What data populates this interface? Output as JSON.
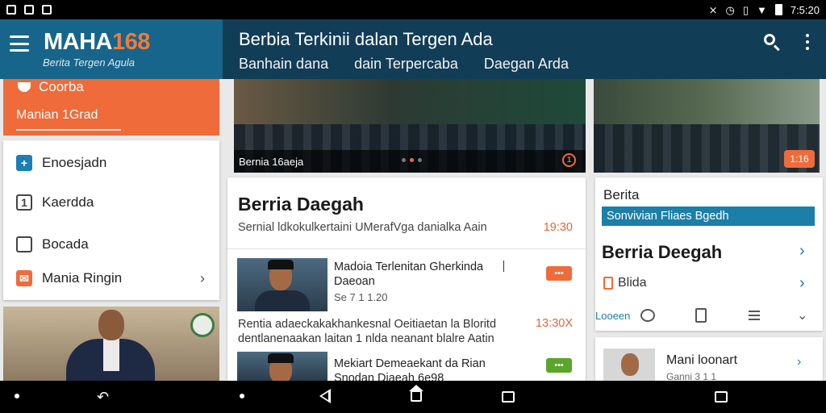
{
  "status_bar": {
    "time": "7:5:20",
    "left_icons": [
      "notification-icon",
      "photo-icon",
      "image-icon"
    ],
    "right_icons": [
      "mute-icon",
      "alarm-icon",
      "vibrate-icon",
      "wifi-icon",
      "battery-icon"
    ]
  },
  "brand": {
    "logo_prefix": "MAHA",
    "logo_suffix": "168",
    "tagline": "Berita Tergen Agula",
    "menu_icon": "hamburger-icon",
    "colors": {
      "brand_blue": "#17658a",
      "accent_orange": "#ef6b3a",
      "header_navy": "#123d57"
    }
  },
  "header": {
    "title": "Berbia Terkinii dalan Tergen Ada",
    "subnav": [
      "Banhain dana",
      "dain  Terpercaba",
      "Daegan  Arda"
    ],
    "search_icon": "search-icon",
    "more_icon": "more-vert-icon"
  },
  "drawer": {
    "head_item": "Coorba",
    "head_sub": "Manian 1Grad",
    "items": [
      {
        "label": "Enoesjadn",
        "icon": "plus-icon"
      },
      {
        "label": "Kaerdda",
        "icon": "box-icon"
      },
      {
        "label": "Bocada",
        "icon": "chat-icon"
      },
      {
        "label": "Mania Ringin",
        "icon": "mail-icon"
      }
    ]
  },
  "featured": {
    "caption": "Bernia 16aeja",
    "badge": "1",
    "right_tag": "1:16"
  },
  "main_card": {
    "title": "Berria Daegah",
    "subtitle": "Sernial ldkokulkertaini UMerafVga danialka Aain",
    "time": "19:30",
    "news1_title": "Madoia Terlenitan  Gherkinda  Daeoan",
    "news1_meta": "Se 7 1 1.20",
    "news1_badge": "•••",
    "news1_desc": "Rentia adaeckakakhankesnal Oeitiaetan la Bloritd dentlanenaakan laitan 1 nlda neanant blalre Aatin",
    "news1_time": "13:30X",
    "news2_title": "Mekiart Demeaekant da Rian Snodan  Diaeah 6e98",
    "news2_badge": "•••"
  },
  "right_card": {
    "kicker": "Berita",
    "strip": "Sonvivian Fliaes Bgedh",
    "title": "Berria Deegah",
    "blida": "Blida",
    "bar_label": "Looeen",
    "second_name": "Mani loonart",
    "second_meta": "Ganni 3 1 1"
  }
}
